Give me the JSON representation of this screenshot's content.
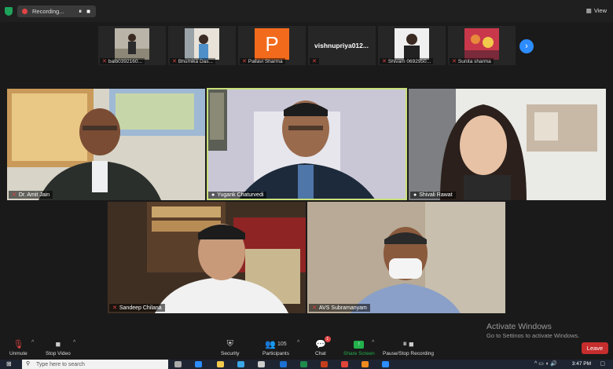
{
  "top_bar": {
    "recording_label": "Recording...",
    "pause_glyph": "⏸",
    "stop_glyph": "■",
    "view_label": "View"
  },
  "strip": {
    "participants": [
      {
        "name": "balb0392160...",
        "muted": true
      },
      {
        "name": "Bhumika Das...",
        "muted": true
      },
      {
        "name": "Pallavi Sharma",
        "muted": true,
        "avatar_letter": "P",
        "avatar_color": "#f26b1d"
      },
      {
        "name": "vishnupriya012...",
        "muted": true
      },
      {
        "name": "Shivam 0692950...",
        "muted": true
      },
      {
        "name": "Sunita sharma",
        "muted": true
      }
    ],
    "next_icon": "chevron-right-icon"
  },
  "gallery": [
    {
      "name": "Dr. Amit Jain",
      "muted": true
    },
    {
      "name": "Yugank Chaturvedi",
      "muted": false,
      "active": true
    },
    {
      "name": "Shivali Rawat",
      "muted": false
    },
    {
      "name": "Sandeep Chilana",
      "muted": true
    },
    {
      "name": "AVS Subramanyam",
      "muted": true
    }
  ],
  "watermark": {
    "title": "Activate Windows",
    "subtitle": "Go to Settings to activate Windows."
  },
  "toolbar": {
    "unmute_label": "Unmute",
    "stop_video_label": "Stop Video",
    "security_label": "Security",
    "participants_label": "Participants",
    "participants_count": "105",
    "chat_label": "Chat",
    "chat_badge": "1",
    "share_label": "Share Screen",
    "record_label": "Pause/Stop Recording",
    "leave_label": "Leave"
  },
  "taskbar": {
    "search_placeholder": "Type here to search",
    "time": "3:47 PM"
  },
  "colors": {
    "accent_blue": "#2d8cff",
    "active_speaker": "#c8e07a",
    "leave_red": "#c62d2d",
    "share_green": "#23b14d"
  }
}
